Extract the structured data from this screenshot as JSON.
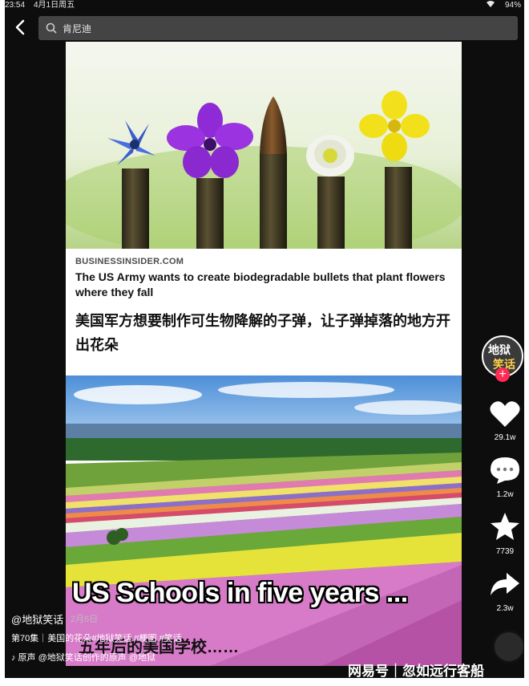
{
  "status": {
    "time": "23:54",
    "date": "4月1日周五",
    "battery": "94%"
  },
  "search": {
    "query": "肯尼迪"
  },
  "article": {
    "source": "BUSINESSINSIDER.COM",
    "headline": "The US Army wants to create biodegradable bullets that plant flowers where they fall",
    "headline_cn": "美国军方想要制作可生物降解的子弹，让子弹掉落的地方开出花朵",
    "overlay_title": "US Schools in five years  ...",
    "subtitle_cn": "五年后的美国学校……"
  },
  "creator": {
    "avatar_text_1": "地狱",
    "avatar_text_2": "笑话"
  },
  "actions": {
    "likes": "29.1w",
    "comments": "1.2w",
    "favorites": "7739",
    "shares": "2.3w"
  },
  "footer": {
    "username": "@地狱笑话",
    "date": "2月6日",
    "description": "第70集｜美国的花朵#地狱笑话 #梗图 #笑话",
    "music": "♪ 原声   @地狱笑话创作的原声   @地狱"
  },
  "watermark": "网易号｜忽如远行客船",
  "colors": {
    "like": "#ffffff",
    "follow": "#fe2c55"
  }
}
